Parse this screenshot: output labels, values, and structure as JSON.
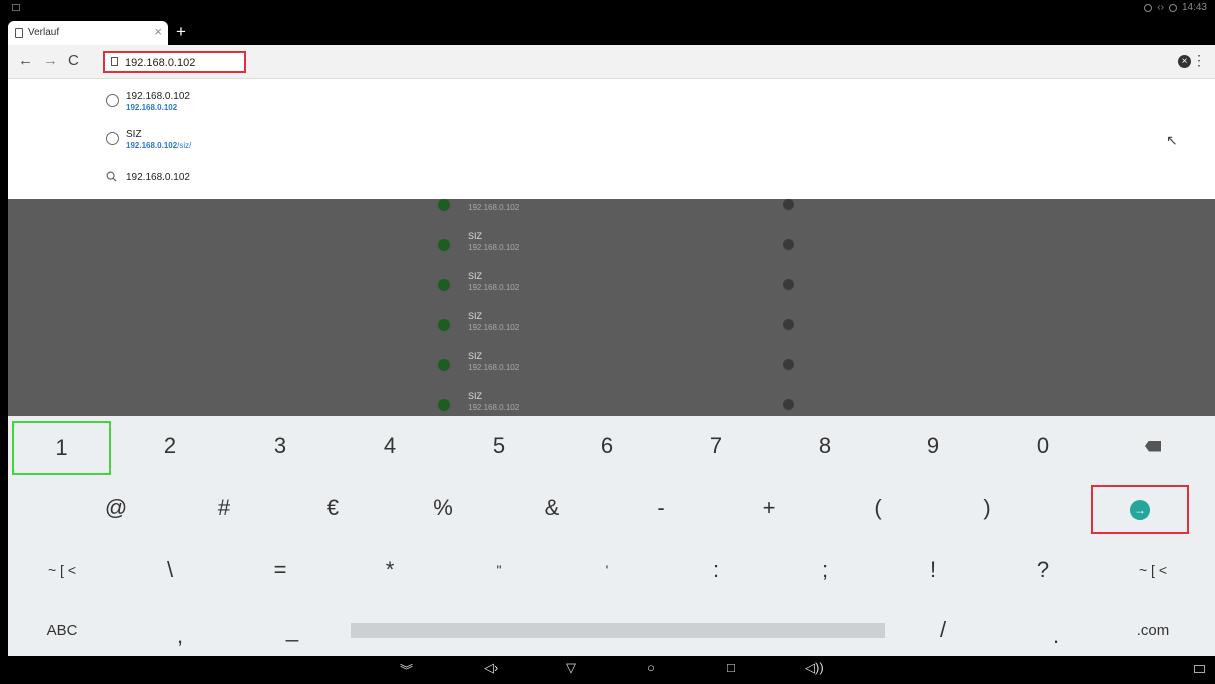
{
  "status": {
    "time": "14:43"
  },
  "tab": {
    "title": "Verlauf",
    "close": "×",
    "new_tab": "+"
  },
  "toolbar": {
    "back": "←",
    "forward": "→",
    "reload": "C",
    "url_value": "192.168.0.102",
    "clear": "×",
    "menu": "⋮"
  },
  "suggestions": [
    {
      "title": "192.168.0.102",
      "url": "192.168.0.102",
      "url_suffix": ""
    },
    {
      "title": "SIZ",
      "url": "192.168.0.102",
      "url_suffix": "/siz/"
    },
    {
      "title": "192.168.0.102"
    }
  ],
  "history": {
    "partial_url": "192.168.0.102",
    "rows": [
      {
        "name": "SIZ",
        "url": "192.168.0.102"
      },
      {
        "name": "SIZ",
        "url": "192.168.0.102"
      },
      {
        "name": "SIZ",
        "url": "192.168.0.102"
      },
      {
        "name": "SIZ",
        "url": "192.168.0.102"
      },
      {
        "name": "SIZ",
        "url": "192.168.0.102"
      }
    ]
  },
  "keyboard": {
    "row1": [
      "1",
      "2",
      "3",
      "4",
      "5",
      "6",
      "7",
      "8",
      "9",
      "0"
    ],
    "row2": [
      "@",
      "#",
      "€",
      "%",
      "&",
      "-",
      "+",
      "(",
      ")"
    ],
    "row3": [
      "~ [ <",
      "\\",
      "=",
      "*",
      "\"",
      "'",
      ":",
      ";",
      "!",
      "?",
      "~ [ <"
    ],
    "row4": {
      "abc": "ABC",
      "comma": ",",
      "underscore": "_",
      "slash": "/",
      "period": ".",
      "dotcom": ".com"
    }
  },
  "icons": {
    "go": "→",
    "nav_down": "︾",
    "vol_down": "◁›",
    "back": "▽",
    "home": "○",
    "recents": "□",
    "vol_up": "◁))"
  }
}
